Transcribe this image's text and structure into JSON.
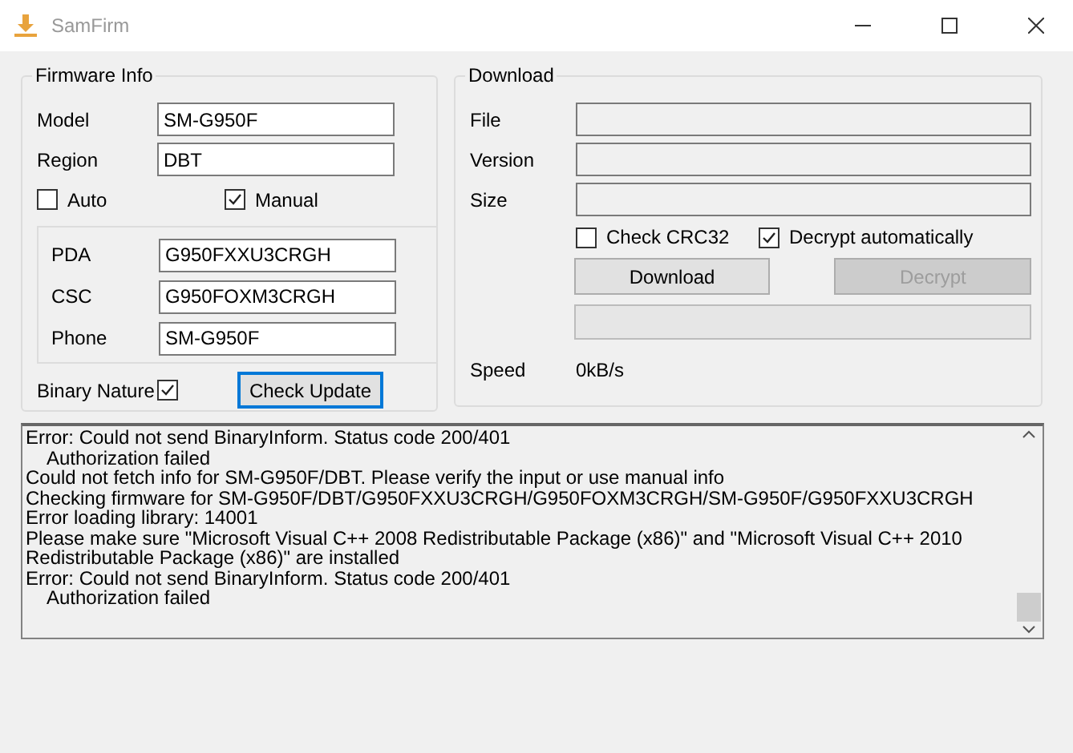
{
  "window": {
    "title": "SamFirm"
  },
  "firmware_info": {
    "title": "Firmware Info",
    "fields": [
      {
        "label": "Model",
        "value": "SM-G950F"
      },
      {
        "label": "Region",
        "value": "DBT"
      }
    ],
    "checkboxes": [
      {
        "label": "Auto",
        "checked": false
      },
      {
        "label": "Manual",
        "checked": true
      }
    ],
    "manual_fields": [
      {
        "label": "PDA",
        "value": "G950FXXU3CRGH"
      },
      {
        "label": "CSC",
        "value": "G950FOXM3CRGH"
      },
      {
        "label": "Phone",
        "value": "SM-G950F"
      }
    ],
    "binary_nature": {
      "label": "Binary Nature",
      "checked": true
    },
    "check_update_button": "Check Update"
  },
  "download": {
    "title": "Download",
    "fields": [
      {
        "label": "File"
      },
      {
        "label": "Version"
      },
      {
        "label": "Size"
      }
    ],
    "checkboxes": [
      {
        "label": "Check CRC32",
        "checked": false
      },
      {
        "label": "Decrypt automatically",
        "checked": true
      }
    ],
    "buttons": [
      {
        "label": "Download",
        "disabled": false
      },
      {
        "label": "Decrypt",
        "disabled": true
      }
    ],
    "progress": {
      "level": 0
    },
    "speed_label": "Speed",
    "speed_value": "0kB/s"
  },
  "log": [
    {
      "text": "Error: Could not send BinaryInform. Status code 200/401",
      "indented": false
    },
    {
      "text": "Authorization failed",
      "indented": true
    },
    {
      "text": "Could not fetch info for SM-G950F/DBT. Please verify the input or use manual info",
      "indented": false
    },
    {
      "text": "Checking firmware for SM-G950F/DBT/G950FXXU3CRGH/G950FOXM3CRGH/SM-G950F/G950FXXU3CRGH",
      "indented": false
    },
    {
      "text": "Error loading library: 14001",
      "indented": false
    },
    {
      "text": "Please make sure \"Microsoft Visual C++ 2008 Redistributable Package (x86)\" and \"Microsoft Visual C++ 2010 Redistributable Package (x86)\" are installed",
      "indented": false
    },
    {
      "text": "Error: Could not send BinaryInform. Status code 200/401",
      "indented": false
    },
    {
      "text": "Authorization failed",
      "indented": true
    }
  ]
}
